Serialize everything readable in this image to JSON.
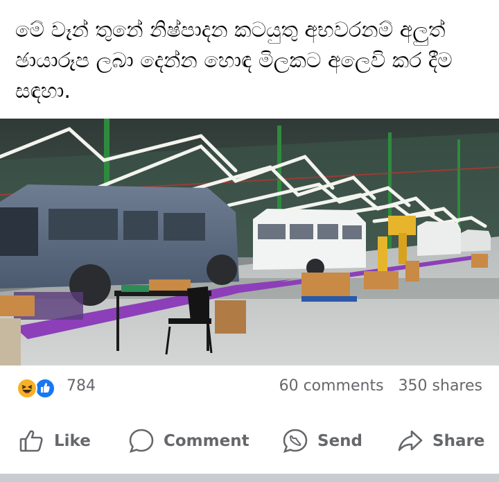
{
  "post": {
    "text": "මේ වෑන් තුනේ නිෂ්පාදන කටයුතු අභවරනම් අලුත් ඡායාරූප ලබා දෙන්න හොඳ මිලකට අලෙවි කර දීම සඳහා."
  },
  "photo": {
    "subject": "van-assembly-line"
  },
  "stats": {
    "reaction_icons": [
      "haha-emoji-icon",
      "like-thumb-icon"
    ],
    "reaction_count": "784",
    "comments": "60 comments",
    "shares": "350 shares"
  },
  "actions": {
    "like": "Like",
    "comment": "Comment",
    "send": "Send",
    "share": "Share"
  },
  "colors": {
    "text": "#050505",
    "secondary": "#65676b",
    "like_blue": "#1877f2",
    "haha_yellow": "#f7b125",
    "bar": "#c9ccd1"
  }
}
